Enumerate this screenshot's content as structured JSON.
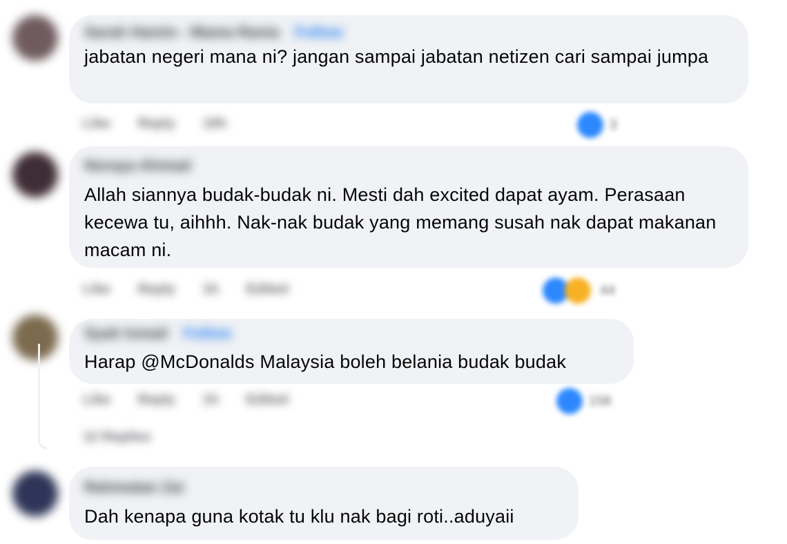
{
  "comments": [
    {
      "author": "Sarah Hanim - Mama Rania",
      "follow_label": "Follow",
      "text": "jabatan negeri mana ni? jangan sampai jabatan netizen cari sampai jumpa",
      "actions": {
        "like": "Like",
        "reply": "Reply",
        "time": "10h"
      },
      "reaction_count": "3",
      "avatar_color": "#6f5b5f"
    },
    {
      "author": "Noraya Ahmad",
      "follow_label": "",
      "text": "Allah siannya budak-budak ni. Mesti dah excited dapat ayam. Perasaan kecewa tu, aihhh. Nak-nak budak yang memang susah nak dapat makanan macam ni.",
      "actions": {
        "like": "Like",
        "reply": "Reply",
        "time": "1h",
        "edited": "Edited"
      },
      "reaction_count": "44",
      "avatar_color": "#3f2d35"
    },
    {
      "author": "Syah Ismail",
      "follow_label": "Follow",
      "text": "Harap @McDonalds Malaysia boleh belania budak budak",
      "actions": {
        "like": "Like",
        "reply": "Reply",
        "time": "1h",
        "edited": "Edited"
      },
      "reaction_count": "156",
      "avatar_color": "#7b6a4e",
      "replies_label": "12 Replies"
    },
    {
      "author": "Rahmatan Zai",
      "follow_label": "",
      "text": "Dah kenapa guna kotak tu klu nak bagi roti..aduyaii",
      "avatar_color": "#2f3558"
    }
  ],
  "colors": {
    "bubble": "#f0f2f5",
    "like_blue": "#2d88ff",
    "haha_yellow": "#f7b125",
    "follow_blue": "#1877f2"
  },
  "icons": [
    "like-reaction-icon",
    "haha-reaction-icon"
  ]
}
